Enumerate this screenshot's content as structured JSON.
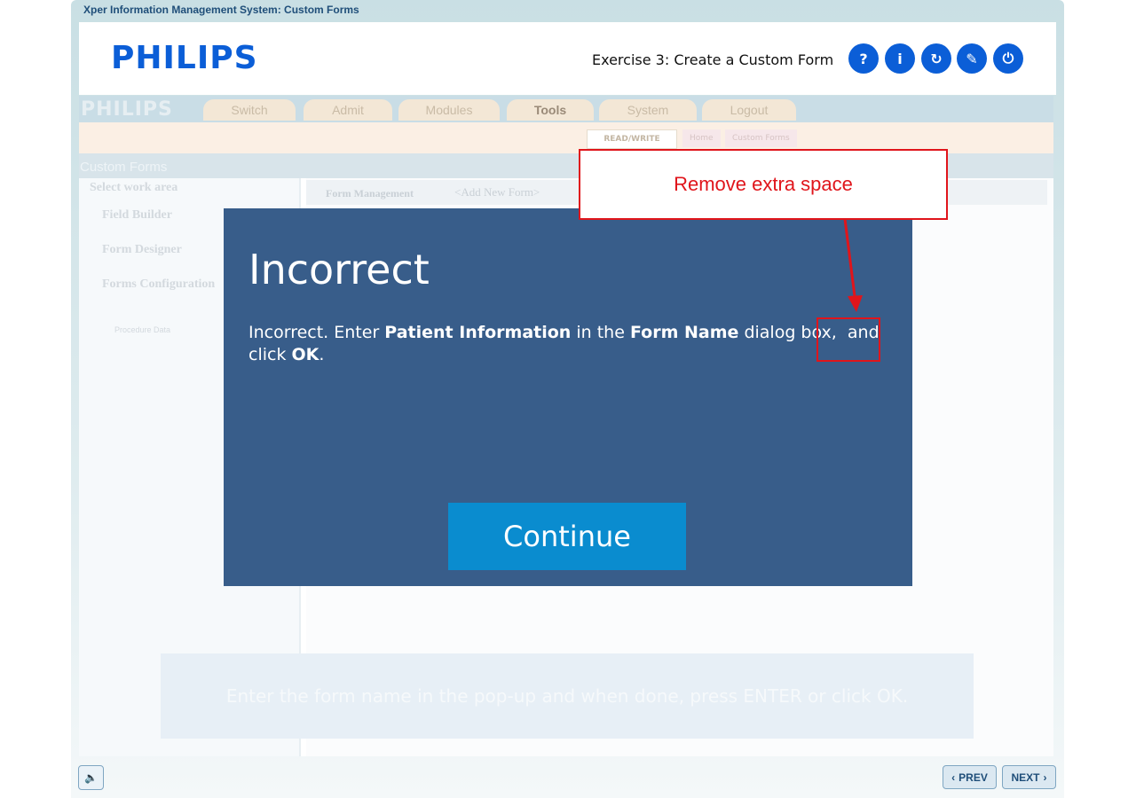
{
  "window": {
    "title": "Xper Information Management System: Custom Forms"
  },
  "header": {
    "logo": "PHILIPS",
    "exercise_title": "Exercise 3: Create a Custom Form",
    "buttons": [
      {
        "name": "help-button",
        "glyph": "?"
      },
      {
        "name": "info-button",
        "glyph": "i"
      },
      {
        "name": "restart-button",
        "glyph": "↻"
      },
      {
        "name": "pen-button",
        "glyph": "✎"
      },
      {
        "name": "exit-button",
        "glyph": "⏻"
      }
    ]
  },
  "background_app": {
    "logo": "PHILIPS",
    "menu": [
      "Switch",
      "Admit",
      "Modules",
      "Tools",
      "System",
      "Logout"
    ],
    "rw_mode": "READ/WRITE",
    "breadcrumbs": [
      "Home",
      "Custom Forms"
    ],
    "section_title": "Custom Forms",
    "left_pane": {
      "heading": "Select work area",
      "options": [
        "Field Builder",
        "Form Designer",
        "Forms Configuration"
      ],
      "tree_item": "Procedure Data"
    },
    "right_pane": {
      "label": "Form Management",
      "add_new": "<Add New Form>"
    },
    "hint": "Enter the form name in the pop-up and when done, press ENTER or click OK."
  },
  "modal": {
    "title": "Incorrect",
    "message_part1": "Incorrect. Enter ",
    "message_bold1": "Patient Information",
    "message_part2": " in the ",
    "message_bold2": "Form Name",
    "message_part3": " dialog box,  and click ",
    "message_bold3": "OK",
    "message_part4": ".",
    "continue_label": "Continue"
  },
  "annotation": {
    "callout_text": "Remove extra space",
    "color": "#e0151b"
  },
  "footer": {
    "prev_label": "PREV",
    "next_label": "NEXT"
  }
}
